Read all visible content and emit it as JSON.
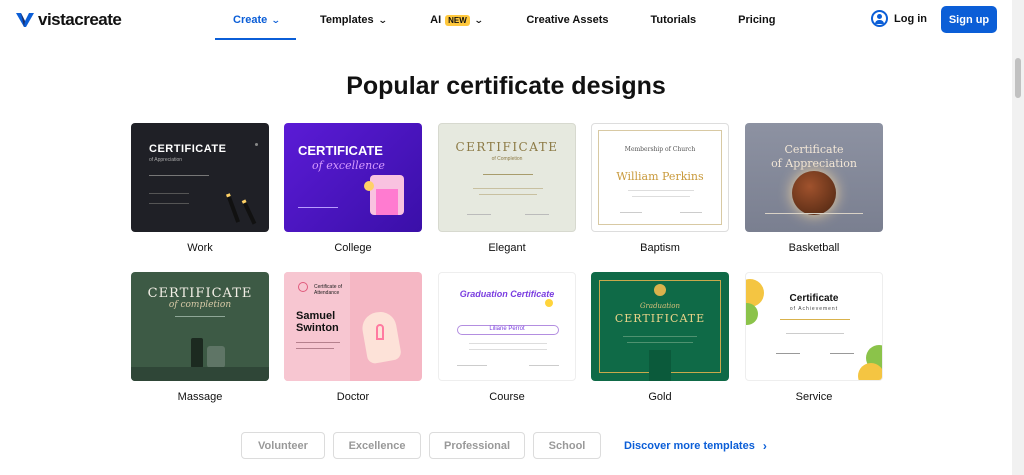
{
  "brand": {
    "name": "vistacreate",
    "accent": "#0b5ed7"
  },
  "nav": {
    "items": [
      {
        "label": "Create",
        "has_dropdown": true,
        "active": true
      },
      {
        "label": "Templates",
        "has_dropdown": true
      },
      {
        "label": "AI",
        "badge": "NEW",
        "has_dropdown": true
      },
      {
        "label": "Creative Assets"
      },
      {
        "label": "Tutorials"
      },
      {
        "label": "Pricing"
      }
    ],
    "login_label": "Log in",
    "signup_label": "Sign up"
  },
  "section_title": "Popular certificate designs",
  "cards": [
    {
      "label": "Work",
      "thumb_title": "CERTIFICATE",
      "thumb_sub": "of Appreciation"
    },
    {
      "label": "College",
      "thumb_title": "CERTIFICATE",
      "thumb_sub": "of excellence"
    },
    {
      "label": "Elegant",
      "thumb_title": "CERTIFICATE",
      "thumb_sub": "of Completion"
    },
    {
      "label": "Baptism",
      "thumb_title": "Membership of Church",
      "thumb_sub": "William Perkins"
    },
    {
      "label": "Basketball",
      "thumb_title": "Certificate",
      "thumb_sub": "of Appreciation"
    },
    {
      "label": "Massage",
      "thumb_title": "CERTIFICATE",
      "thumb_sub": "of completion"
    },
    {
      "label": "Doctor",
      "thumb_title": "Samuel Swinton",
      "thumb_sub": "Certificate of Attendance"
    },
    {
      "label": "Course",
      "thumb_title": "Graduation Certificate",
      "thumb_sub": "Liliane Perrot"
    },
    {
      "label": "Gold",
      "thumb_title": "CERTIFICATE",
      "thumb_sub": "Graduation"
    },
    {
      "label": "Service",
      "thumb_title": "Certificate",
      "thumb_sub": "of Achievement"
    }
  ],
  "tags": [
    "Volunteer",
    "Excellence",
    "Professional",
    "School"
  ],
  "discover_label": "Discover more templates"
}
